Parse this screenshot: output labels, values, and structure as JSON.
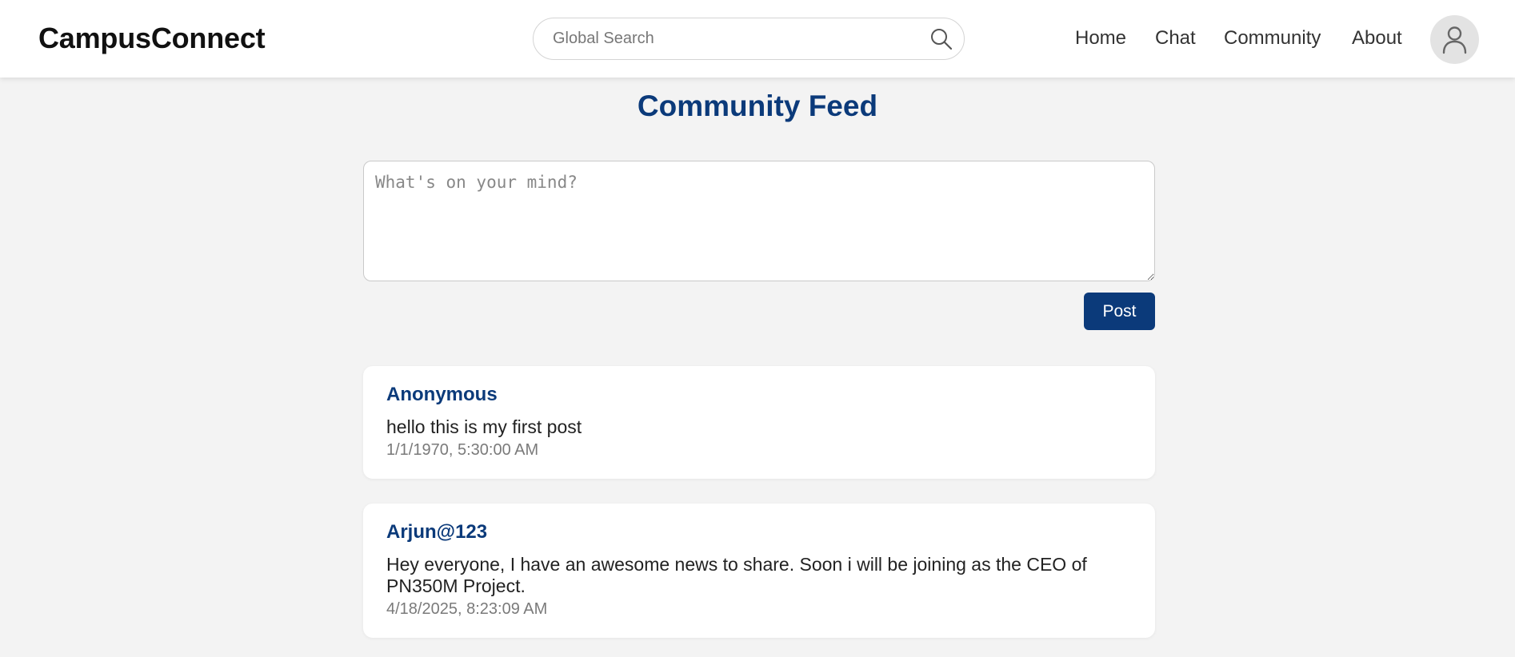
{
  "header": {
    "brand": "CampusConnect",
    "search_placeholder": "Global Search",
    "nav": {
      "home": "Home",
      "chat": "Chat",
      "community": "Community",
      "about": "About"
    },
    "search_icon": "search-icon",
    "avatar_icon": "user-icon"
  },
  "main": {
    "title": "Community Feed",
    "composer_placeholder": "What's on your mind?",
    "post_label": "Post"
  },
  "posts": [
    {
      "author": "Anonymous",
      "body": "hello this is my first post",
      "timestamp": "1/1/1970, 5:30:00 AM"
    },
    {
      "author": "Arjun@123",
      "body": "Hey everyone, I have an awesome news to share. Soon i will be joining as the CEO of PN350M Project.",
      "timestamp": "4/18/2025, 8:23:09 AM"
    }
  ],
  "colors": {
    "accent": "#0b3a7a",
    "background": "#f3f3f3",
    "card": "#ffffff"
  }
}
